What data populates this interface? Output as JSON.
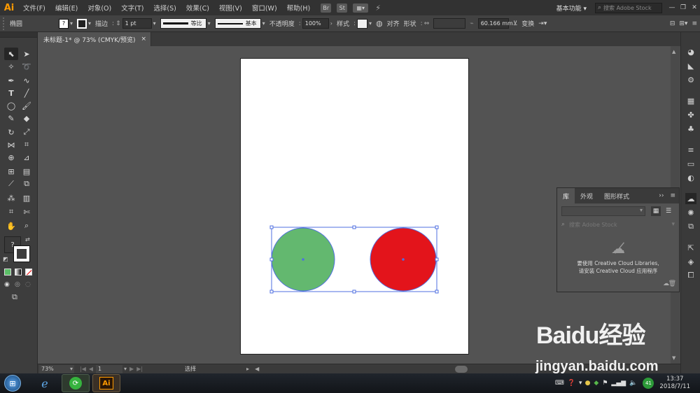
{
  "app": {
    "logo": "Ai"
  },
  "menus": [
    "文件(F)",
    "编辑(E)",
    "对象(O)",
    "文字(T)",
    "选择(S)",
    "效果(C)",
    "视图(V)",
    "窗口(W)",
    "帮助(H)"
  ],
  "menubar_badges": [
    "Br",
    "St"
  ],
  "workspace": "基本功能",
  "stock_search_placeholder": "搜索 Adobe Stock",
  "control": {
    "object_type": "椭圆",
    "stroke_label": "描边",
    "stroke_weight": "1 pt",
    "profile_label": "等比",
    "brush_label": "基本",
    "opacity_label": "不透明度",
    "opacity_value": "100%",
    "style_label": "样式",
    "align_label": "对齐",
    "shape_label": "形状",
    "width_value": "60.166 mm",
    "transform_label": "变换",
    "fill_q": "?"
  },
  "doc_tab": {
    "title": "未标题-1* @ 73% (CMYK/预览)",
    "close": "×"
  },
  "canvas": {
    "shapes": [
      {
        "name": "green-circle",
        "color": "#63b86f"
      },
      {
        "name": "red-circle",
        "color": "#e3141b"
      }
    ],
    "selection_color": "#4f6fe0"
  },
  "panel": {
    "tabs": [
      "库",
      "外观",
      "图形样式"
    ],
    "search_placeholder": "搜索 Adobe Stock",
    "message_line1": "要使用 Creative Cloud Libraries,",
    "message_line2": "请安装 Creative Cloud 应用程序"
  },
  "status": {
    "zoom": "73%",
    "page": "1",
    "mode": "选择"
  },
  "taskbar": {
    "time": "13:37",
    "date": "2018/7/11",
    "badge": "41"
  },
  "watermark": {
    "brand": "Baidu经验",
    "url": "jingyan.baidu.com"
  }
}
